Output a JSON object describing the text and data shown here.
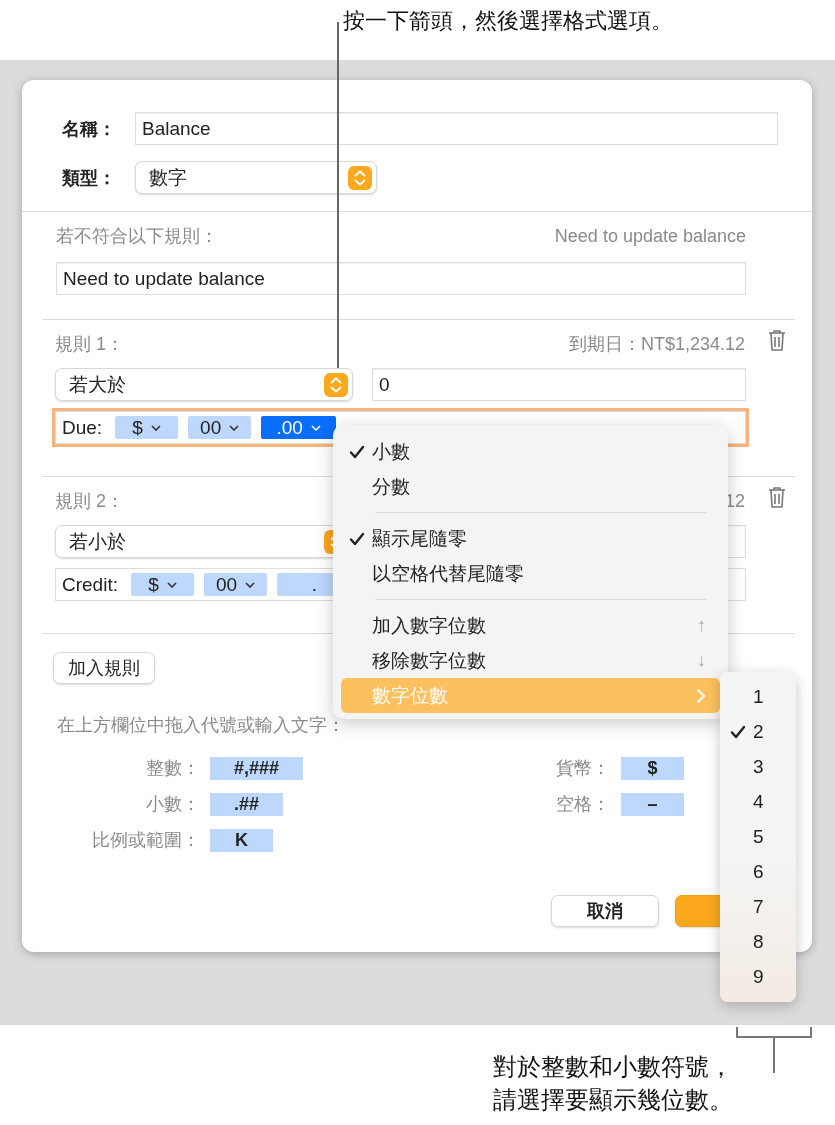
{
  "callouts": [
    {
      "kind": "top",
      "lines": [
        "按一下箭頭，然後選擇格式選項。"
      ]
    },
    {
      "kind": "bottom",
      "lines": [
        "對於整數和小數符號，",
        "請選擇要顯示幾位數。"
      ]
    }
  ],
  "dialog": {
    "name_label": "名稱：",
    "name_value": "Balance",
    "type_label": "類型：",
    "type_value": "數字",
    "fallback": {
      "label": "若不符合以下規則：",
      "preview": "Need to update balance",
      "value": "Need to update balance"
    },
    "rules": [
      {
        "label": "規則 1：",
        "preview": "到期日：NT$1,234.12",
        "condition": "若大於",
        "value": "0",
        "focused": true,
        "prefix": "Due:",
        "tokens": [
          {
            "text": "$",
            "selected": false
          },
          {
            "text": "00",
            "selected": false
          },
          {
            "text": ".00",
            "selected": true
          }
        ]
      },
      {
        "label": "規則 2：",
        "preview": "12",
        "condition": "若小於",
        "focused": false,
        "prefix": "Credit:",
        "tokens": [
          {
            "text": "$",
            "selected": false
          },
          {
            "text": "00",
            "selected": false
          },
          {
            "text": ".",
            "selected": false,
            "caret": false
          }
        ]
      }
    ],
    "add_rule": "加入規則",
    "hint": "在上方欄位中拖入代號或輸入文字：",
    "symbols_left": [
      {
        "label": "整數：",
        "token": "#,###"
      },
      {
        "label": "小數：",
        "token": ".##"
      },
      {
        "label": "比例或範圍：",
        "token": "K"
      }
    ],
    "symbols_right": [
      {
        "label": "貨幣：",
        "token": "$"
      },
      {
        "label": "空格：",
        "token": "–"
      }
    ],
    "buttons": [
      {
        "kind": "cancel",
        "label": "取消"
      },
      {
        "kind": "default"
      }
    ]
  },
  "menu": {
    "groups": [
      [
        {
          "label": "小數",
          "checked": true,
          "selected": false
        },
        {
          "label": "分數",
          "checked": false,
          "selected": false
        }
      ],
      [
        {
          "label": "顯示尾隨零",
          "checked": true,
          "selected": false
        },
        {
          "label": "以空格代替尾隨零",
          "checked": false,
          "selected": false
        }
      ],
      [
        {
          "label": "加入數字位數",
          "checked": false,
          "selected": false,
          "shortcut": "↑"
        },
        {
          "label": "移除數字位數",
          "checked": false,
          "selected": false,
          "shortcut": "↓"
        },
        {
          "label": "數字位數",
          "checked": false,
          "selected": true,
          "submenu": true
        }
      ]
    ]
  },
  "submenu": {
    "items": [
      {
        "label": "1",
        "checked": false
      },
      {
        "label": "2",
        "checked": true
      },
      {
        "label": "3",
        "checked": false
      },
      {
        "label": "4",
        "checked": false
      },
      {
        "label": "5",
        "checked": false
      },
      {
        "label": "6",
        "checked": false
      },
      {
        "label": "7",
        "checked": false
      },
      {
        "label": "8",
        "checked": false
      },
      {
        "label": "9",
        "checked": false
      }
    ]
  }
}
